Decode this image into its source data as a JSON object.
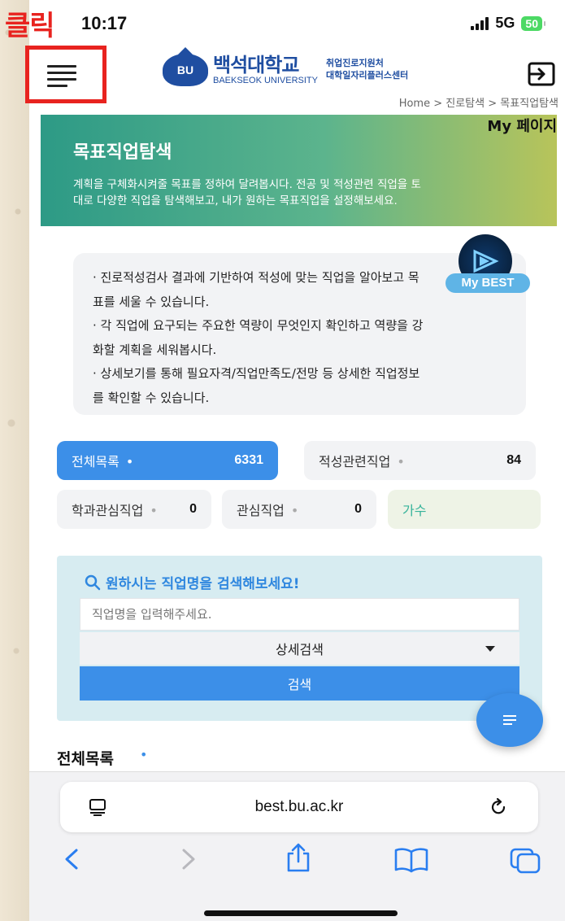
{
  "annotation": {
    "click_label": "클릭"
  },
  "status_bar": {
    "time": "10:17",
    "network": "5G",
    "battery": "50"
  },
  "header": {
    "logo_kr": "백석대학교",
    "logo_en": "BAEKSEOK UNIVERSITY",
    "logo_emblem": "BU",
    "center_line1": "취업진로지원처",
    "center_line2": "대학일자리플러스센터",
    "icons": {
      "menu": "hamburger-menu-icon",
      "exit": "logout-icon"
    }
  },
  "breadcrumb": "Home > 진로탐색 > 목표직업탐색",
  "hero": {
    "mypage_label": "My 페이지",
    "title": "목표직업탐색",
    "desc_line1": "계획을 구체화시켜줄 목표를 정하여 달려봅시다. 전공 및 적성관련 직업을 토",
    "desc_line2": "대로 다양한 직업을 탐색해보고, 내가 원하는 목표직업을 설정해보세요."
  },
  "info_lines": [
    "· 진로적성검사 결과에 기반하여 적성에 맞는 직업을 알아보고 목",
    "표를 세울 수 있습니다.",
    "· 각 직업에 요구되는 주요한 역량이 무엇인지 확인하고 역량을 강",
    "화할 계획을 세워봅시다.",
    "· 상세보기를 통해 필요자격/직업만족도/전망 등 상세한 직업정보",
    "를 확인할 수 있습니다."
  ],
  "mybest_label": "My BEST",
  "stats": {
    "all": {
      "label": "전체목록",
      "count": "6331"
    },
    "aptitude": {
      "label": "적성관련직업",
      "count": "84"
    },
    "major": {
      "label": "학과관심직업",
      "count": "0"
    },
    "interest": {
      "label": "관심직업",
      "count": "0"
    },
    "selected_job": "가수",
    "dot": "•"
  },
  "search": {
    "title": "원하시는 직업명을 검색해보세요!",
    "placeholder": "직업명을 입력해주세요.",
    "detail_label": "상세검색",
    "button_label": "검색"
  },
  "list_heading": "전체목록",
  "safari": {
    "url": "best.bu.ac.kr"
  }
}
